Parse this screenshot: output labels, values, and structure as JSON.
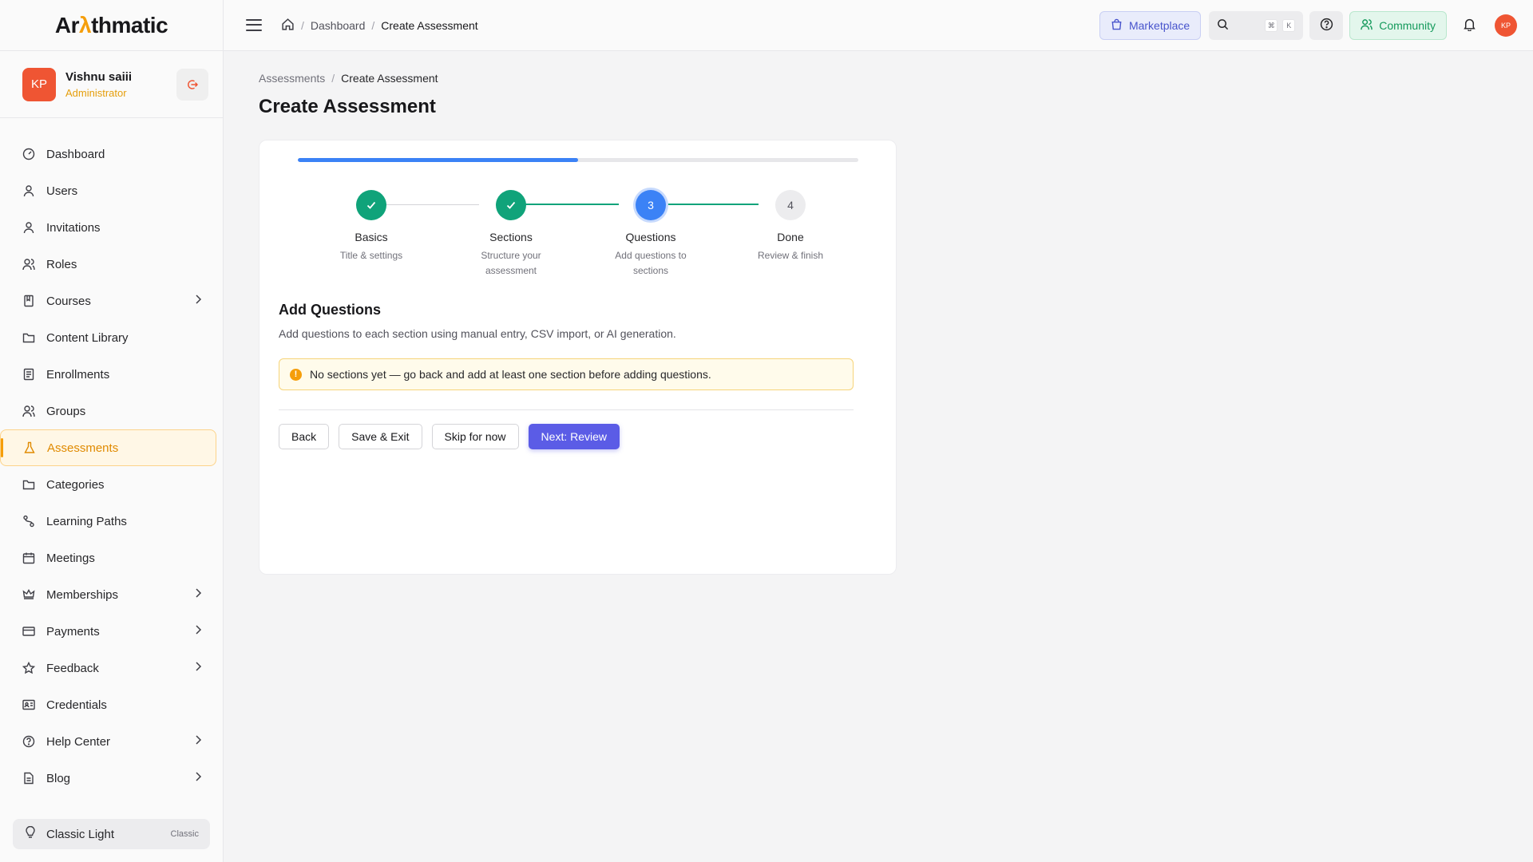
{
  "brand": {
    "logo_pre": "Ar",
    "logo_accent": "λ",
    "logo_post": "thmatic"
  },
  "user": {
    "initials": "KP",
    "name": "Vishnu saiii",
    "role": "Administrator"
  },
  "sidebar": {
    "items": [
      {
        "label": "Dashboard",
        "icon": "dashboard-icon",
        "chevron": false
      },
      {
        "label": "Users",
        "icon": "user-icon",
        "chevron": false
      },
      {
        "label": "Invitations",
        "icon": "user-icon",
        "chevron": false
      },
      {
        "label": "Roles",
        "icon": "users-icon",
        "chevron": false
      },
      {
        "label": "Courses",
        "icon": "book-icon",
        "chevron": true
      },
      {
        "label": "Content Library",
        "icon": "folder-icon",
        "chevron": false
      },
      {
        "label": "Enrollments",
        "icon": "list-icon",
        "chevron": false
      },
      {
        "label": "Groups",
        "icon": "users-icon",
        "chevron": false
      },
      {
        "label": "Assessments",
        "icon": "flask-icon",
        "chevron": false,
        "active": true
      },
      {
        "label": "Categories",
        "icon": "folder-icon",
        "chevron": false
      },
      {
        "label": "Learning Paths",
        "icon": "path-icon",
        "chevron": false
      },
      {
        "label": "Meetings",
        "icon": "calendar-icon",
        "chevron": false
      },
      {
        "label": "Memberships",
        "icon": "crown-icon",
        "chevron": true
      },
      {
        "label": "Payments",
        "icon": "card-icon",
        "chevron": true
      },
      {
        "label": "Feedback",
        "icon": "star-icon",
        "chevron": true
      },
      {
        "label": "Credentials",
        "icon": "id-card-icon",
        "chevron": false
      },
      {
        "label": "Help Center",
        "icon": "help-icon",
        "chevron": true
      },
      {
        "label": "Blog",
        "icon": "document-icon",
        "chevron": true
      }
    ],
    "theme": {
      "label": "Classic Light",
      "tag": "Classic"
    }
  },
  "topbar": {
    "crumbs": [
      "Dashboard",
      "Create Assessment"
    ],
    "marketplace": "Marketplace",
    "kbd": [
      "⌘",
      "K"
    ],
    "community": "Community",
    "avatar": "KP"
  },
  "page": {
    "crumbs": [
      "Assessments",
      "Create Assessment"
    ],
    "title": "Create Assessment"
  },
  "wizard": {
    "progress": 0.5,
    "steps": [
      {
        "number": "1",
        "title": "Basics",
        "subtitle": "Title & settings",
        "state": "done"
      },
      {
        "number": "2",
        "title": "Sections",
        "subtitle": "Structure your assessment",
        "state": "done"
      },
      {
        "number": "3",
        "title": "Questions",
        "subtitle": "Add questions to sections",
        "state": "current"
      },
      {
        "number": "4",
        "title": "Done",
        "subtitle": "Review & finish",
        "state": "todo"
      }
    ],
    "section_title": "Add Questions",
    "section_desc": "Add questions to each section using manual entry, CSV import, or AI generation.",
    "alert": "No sections yet — go back and add at least one section before adding questions.",
    "alert_icon": "!",
    "buttons": {
      "back": "Back",
      "save_exit": "Save & Exit",
      "skip": "Skip for now",
      "next": "Next: Review"
    }
  },
  "colors": {
    "accent": "#f59e0b",
    "primary": "#5b5ce6",
    "success": "#10a37a",
    "progress": "#3b82f6"
  }
}
